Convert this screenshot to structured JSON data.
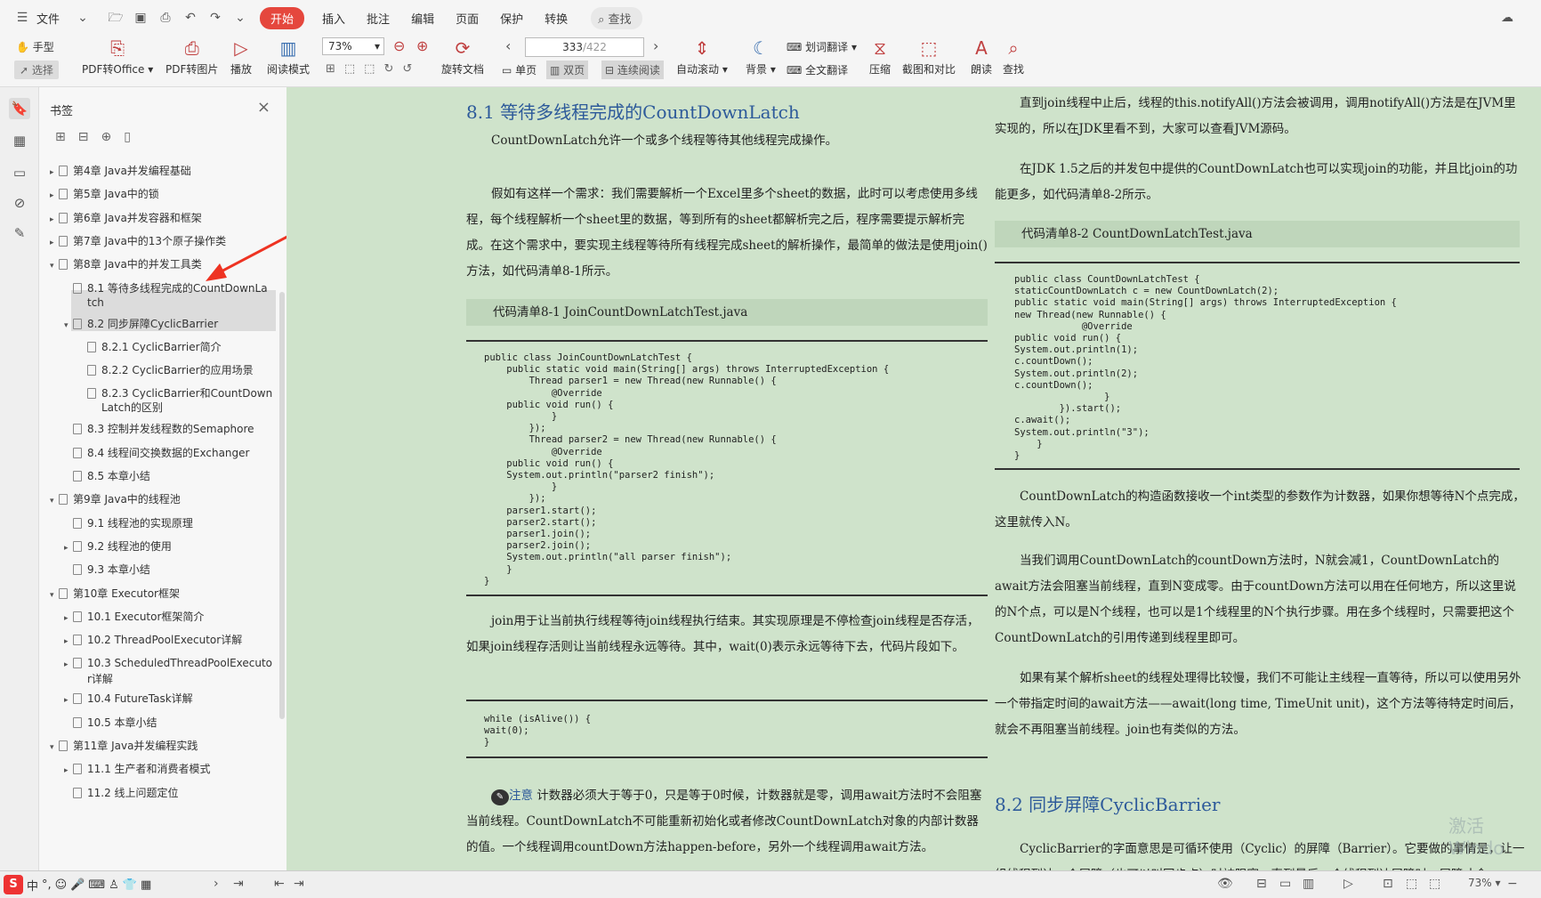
{
  "menu": {
    "file": "文件",
    "tabs": [
      "开始",
      "插入",
      "批注",
      "编辑",
      "页面",
      "保护",
      "转换"
    ],
    "active_tab": "开始",
    "search": "查找"
  },
  "ribbon": {
    "hand": "手型",
    "select": "选择",
    "pdf_to_office": "PDF转Office",
    "pdf_to_image": "PDF转图片",
    "play": "播放",
    "read_mode": "阅读模式",
    "zoom": "73%",
    "rotate": "旋转文档",
    "page_current": "333",
    "page_total": "/422",
    "single": "单页",
    "double": "双页",
    "continuous": "连续阅读",
    "auto_scroll": "自动滚动",
    "background": "背景",
    "word_translate": "划词翻译",
    "full_translate": "全文翻译",
    "compress": "压缩",
    "screenshot": "截图和对比",
    "read_aloud": "朗读",
    "find": "查找"
  },
  "bookmarks": {
    "title": "书签",
    "items": [
      {
        "label": "第4章 Java并发编程基础",
        "level": 0,
        "arrow": "▸"
      },
      {
        "label": "第5章 Java中的锁",
        "level": 0,
        "arrow": "▸"
      },
      {
        "label": "第6章 Java并发容器和框架",
        "level": 0,
        "arrow": "▸"
      },
      {
        "label": "第7章 Java中的13个原子操作类",
        "level": 0,
        "arrow": "▸"
      },
      {
        "label": "第8章 Java中的并发工具类",
        "level": 0,
        "arrow": "▾"
      },
      {
        "label": "8.1 等待多线程完成的CountDownLa",
        "label2": "tch",
        "level": 1,
        "arrow": ""
      },
      {
        "label": "8.2 同步屏障CyclicBarrier",
        "level": 1,
        "arrow": "▾"
      },
      {
        "label": "8.2.1 CyclicBarrier简介",
        "level": 2,
        "arrow": ""
      },
      {
        "label": "8.2.2 CyclicBarrier的应用场景",
        "level": 2,
        "arrow": ""
      },
      {
        "label": "8.2.3 CyclicBarrier和CountDown",
        "label2": "Latch的区别",
        "level": 2,
        "arrow": ""
      },
      {
        "label": "8.3 控制并发线程数的Semaphore",
        "level": 1,
        "arrow": ""
      },
      {
        "label": "8.4 线程间交换数据的Exchanger",
        "level": 1,
        "arrow": ""
      },
      {
        "label": "8.5 本章小结",
        "level": 1,
        "arrow": ""
      },
      {
        "label": "第9章 Java中的线程池",
        "level": 0,
        "arrow": "▾"
      },
      {
        "label": "9.1 线程池的实现原理",
        "level": 1,
        "arrow": ""
      },
      {
        "label": "9.2 线程池的使用",
        "level": 1,
        "arrow": "▸"
      },
      {
        "label": "9.3 本章小结",
        "level": 1,
        "arrow": ""
      },
      {
        "label": "第10章 Executor框架",
        "level": 0,
        "arrow": "▾"
      },
      {
        "label": "10.1 Executor框架简介",
        "level": 1,
        "arrow": "▸"
      },
      {
        "label": "10.2 ThreadPoolExecutor详解",
        "level": 1,
        "arrow": "▸"
      },
      {
        "label": "10.3 ScheduledThreadPoolExecuto",
        "label2": "r详解",
        "level": 1,
        "arrow": "▸"
      },
      {
        "label": "10.4 FutureTask详解",
        "level": 1,
        "arrow": "▸"
      },
      {
        "label": "10.5 本章小结",
        "level": 1,
        "arrow": ""
      },
      {
        "label": "第11章 Java并发编程实践",
        "level": 0,
        "arrow": "▾"
      },
      {
        "label": "11.1 生产者和消费者模式",
        "level": 1,
        "arrow": "▸"
      },
      {
        "label": "11.2 线上问题定位",
        "level": 1,
        "arrow": ""
      }
    ]
  },
  "doc": {
    "left": {
      "heading": "8.1  等待多线程完成的CountDownLatch",
      "p1": "CountDownLatch允许一个或多个线程等待其他线程完成操作。",
      "p2": "假如有这样一个需求：我们需要解析一个Excel里多个sheet的数据，此时可以考虑使用多线程，每个线程解析一个sheet里的数据，等到所有的sheet都解析完之后，程序需要提示解析完成。在这个需求中，要实现主线程等待所有线程完成sheet的解析操作，最简单的做法是使用join()方法，如代码清单8-1所示。",
      "cap1": "代码清单8-1   JoinCountDownLatchTest.java",
      "code1": "public class JoinCountDownLatchTest {\n    public static void main(String[] args) throws InterruptedException {\n        Thread parser1 = new Thread(new Runnable() {\n            @Override\n    public void run() {\n            }\n        });\n        Thread parser2 = new Thread(new Runnable() {\n            @Override\n    public void run() {\n    System.out.println(\"parser2 finish\");\n            }\n        });\n    parser1.start();\n    parser2.start();\n    parser1.join();\n    parser2.join();\n    System.out.println(\"all parser finish\");\n    }\n}",
      "p3": "join用于让当前执行线程等待join线程执行结束。其实现原理是不停检查join线程是否存活，如果join线程存活则让当前线程永远等待。其中，wait(0)表示永远等待下去，代码片段如下。",
      "code2": "while (isAlive()) {\nwait(0);\n}",
      "note_label": "注意",
      "note": "  计数器必须大于等于0，只是等于0时候，计数器就是零，调用await方法时不会阻塞当前线程。CountDownLatch不可能重新初始化或者修改CountDownLatch对象的内部计数器的值。一个线程调用countDown方法happen-before，另外一个线程调用await方法。"
    },
    "right": {
      "p1": "直到join线程中止后，线程的this.notifyAll()方法会被调用，调用notifyAll()方法是在JVM里实现的，所以在JDK里看不到，大家可以查看JVM源码。",
      "p2": "在JDK 1.5之后的并发包中提供的CountDownLatch也可以实现join的功能，并且比join的功能更多，如代码清单8-2所示。",
      "cap2": "代码清单8-2   CountDownLatchTest.java",
      "code3": "public class CountDownLatchTest {\nstaticCountDownLatch c = new CountDownLatch(2);\npublic static void main(String[] args) throws InterruptedException {\nnew Thread(new Runnable() {\n            @Override\npublic void run() {\nSystem.out.println(1);\nc.countDown();\nSystem.out.println(2);\nc.countDown();\n                }\n        }).start();\nc.await();\nSystem.out.println(\"3\");\n    }\n}",
      "p3": "CountDownLatch的构造函数接收一个int类型的参数作为计数器，如果你想等待N个点完成，这里就传入N。",
      "p4": "当我们调用CountDownLatch的countDown方法时，N就会减1，CountDownLatch的await方法会阻塞当前线程，直到N变成零。由于countDown方法可以用在任何地方，所以这里说的N个点，可以是N个线程，也可以是1个线程里的N个执行步骤。用在多个线程时，只需要把这个CountDownLatch的引用传递到线程里即可。",
      "p5": "如果有某个解析sheet的线程处理得比较慢，我们不可能让主线程一直等待，所以可以使用另外一个带指定时间的await方法——await(long time, TimeUnit unit)，这个方法等待特定时间后，就会不再阻塞当前线程。join也有类似的方法。",
      "heading2": "8.2  同步屏障CyclicBarrier",
      "p6": "CyclicBarrier的字面意思是可循环使用（Cyclic）的屏障（Barrier）。它要做的事情是，让一组线程到达一个屏障（也可以叫同步点）时被阻塞，直到最后一个线程到达屏障时，屏障才会"
    }
  },
  "watermark": "激活 Windo",
  "status": {
    "zoom": "73%",
    "ime_label": "中"
  }
}
